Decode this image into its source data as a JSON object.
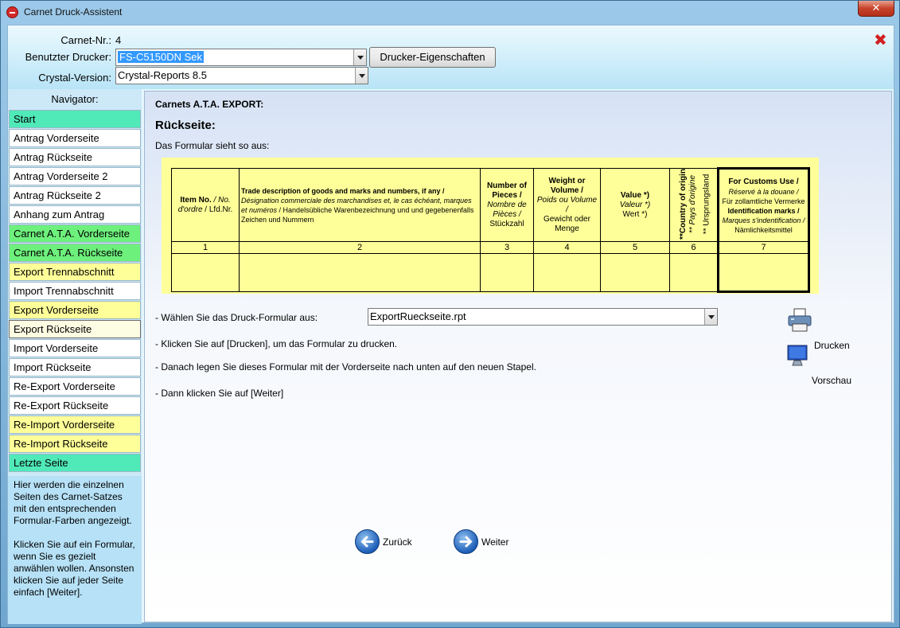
{
  "window": {
    "title": "Carnet Druck-Assistent",
    "close_glyph": "✕"
  },
  "header": {
    "carnet_label": "Carnet-Nr.:",
    "carnet_value": "4",
    "printer_label": "Benutzter Drucker:",
    "printer_value": "FS-C5150DN Sek",
    "printer_props_button": "Drucker-Eigenschaften",
    "crystal_label": "Crystal-Version:",
    "crystal_value": "Crystal-Reports 8.5",
    "close_icon_glyph": "✖"
  },
  "navigator": {
    "title": "Navigator:",
    "items": [
      {
        "label": "Start",
        "color": "teal"
      },
      {
        "label": "Antrag Vorderseite",
        "color": "white"
      },
      {
        "label": "Antrag Rückseite",
        "color": "white"
      },
      {
        "label": "Antrag Vorderseite 2",
        "color": "white"
      },
      {
        "label": "Antrag Rückseite 2",
        "color": "white"
      },
      {
        "label": "Anhang zum Antrag",
        "color": "white"
      },
      {
        "label": "Carnet A.T.A. Vorderseite",
        "color": "green"
      },
      {
        "label": "Carnet A.T.A. Rückseite",
        "color": "green"
      },
      {
        "label": "Export Trennabschnitt",
        "color": "yellow"
      },
      {
        "label": "Import Trennabschnitt",
        "color": "white"
      },
      {
        "label": "Export Vorderseite",
        "color": "yellow"
      },
      {
        "label": "Export Rückseite",
        "color": "active"
      },
      {
        "label": "Import Vorderseite",
        "color": "white"
      },
      {
        "label": "Import Rückseite",
        "color": "white"
      },
      {
        "label": "Re-Export Vorderseite",
        "color": "white"
      },
      {
        "label": "Re-Export Rückseite",
        "color": "white"
      },
      {
        "label": "Re-Import Vorderseite",
        "color": "yellow"
      },
      {
        "label": "Re-Import Rückseite",
        "color": "yellow"
      },
      {
        "label": "Letzte Seite",
        "color": "teal"
      }
    ],
    "help_1": "Hier werden die einzelnen Seiten des Carnet-Satzes mit den entsprechenden Formular-Farben angezeigt.",
    "help_2": "Klicken Sie auf ein Formular, wenn Sie es gezielt anwählen wollen. Ansonsten klicken Sie auf jeder Seite einfach [Weiter]."
  },
  "main": {
    "section": "Carnets A.T.A. EXPORT:",
    "heading": "Rückseite:",
    "form_intro": "Das Formular sieht so aus:",
    "form": {
      "col1_en": "Item No.",
      "col1_fr": "/ No. d'ordre",
      "col1_de": "/ Lfd.Nr.",
      "col2_en": "Trade description of goods and marks and numbers, if any /",
      "col2_fr": "Désignation commerciale des marchandises et, le cas échéant, marques et numéros",
      "col2_de": "/ Handelsübliche Warenbezeichnung und und gegebenenfalls Zeichen und Nummern",
      "col3_en": "Number of Pieces /",
      "col3_fr": "Nombre de Pièces /",
      "col3_de": "Stückzahl",
      "col4_en": "Weight or Volume /",
      "col4_fr": "Poids ou Volume /",
      "col4_de": "Gewicht oder Menge",
      "col5_en": "Value *)",
      "col5_fr": "Valeur *)",
      "col5_de": "Wert *)",
      "col6_en": "**Country of origin",
      "col6_fr": "** Pays d'origine",
      "col6_de": "** Ursprungsland",
      "col7_en": "For Customs Use /",
      "col7_fr": "Réservé à la douane /",
      "col7_de": "Für zollamtliche Vermerke",
      "col7_en2": "Identification marks /",
      "col7_fr2": "Marques s'indentification /",
      "col7_de2": "Nämlichkeitsmittel",
      "numbers": [
        "1",
        "2",
        "3",
        "4",
        "5",
        "6",
        "7"
      ]
    },
    "step_select": "- Wählen Sie das Druck-Formular aus:",
    "report_value": "ExportRueckseite.rpt",
    "step_print": "- Klicken Sie auf [Drucken], um das Formular zu drucken.",
    "step_stack": "- Danach legen Sie dieses Formular mit der Vorderseite nach unten auf den neuen Stapel.",
    "step_next": "- Dann klicken Sie auf [Weiter]",
    "print_label": "Drucken",
    "preview_label": "Vorschau",
    "back_label": "Zurück",
    "next_label": "Weiter"
  },
  "colors": {
    "teal": "#50e9b8",
    "green": "#6ef07c",
    "yellow": "#ffff99",
    "white": "#ffffff",
    "active": "#fdfde3",
    "form_bg": "#ffff99",
    "nav_arrow": "#1c5eb8"
  },
  "icons": {
    "window": "app-stop-icon",
    "close": "close-icon",
    "print": "printer-icon",
    "preview": "monitor-icon",
    "back": "arrow-left-icon",
    "next": "arrow-right-icon"
  }
}
